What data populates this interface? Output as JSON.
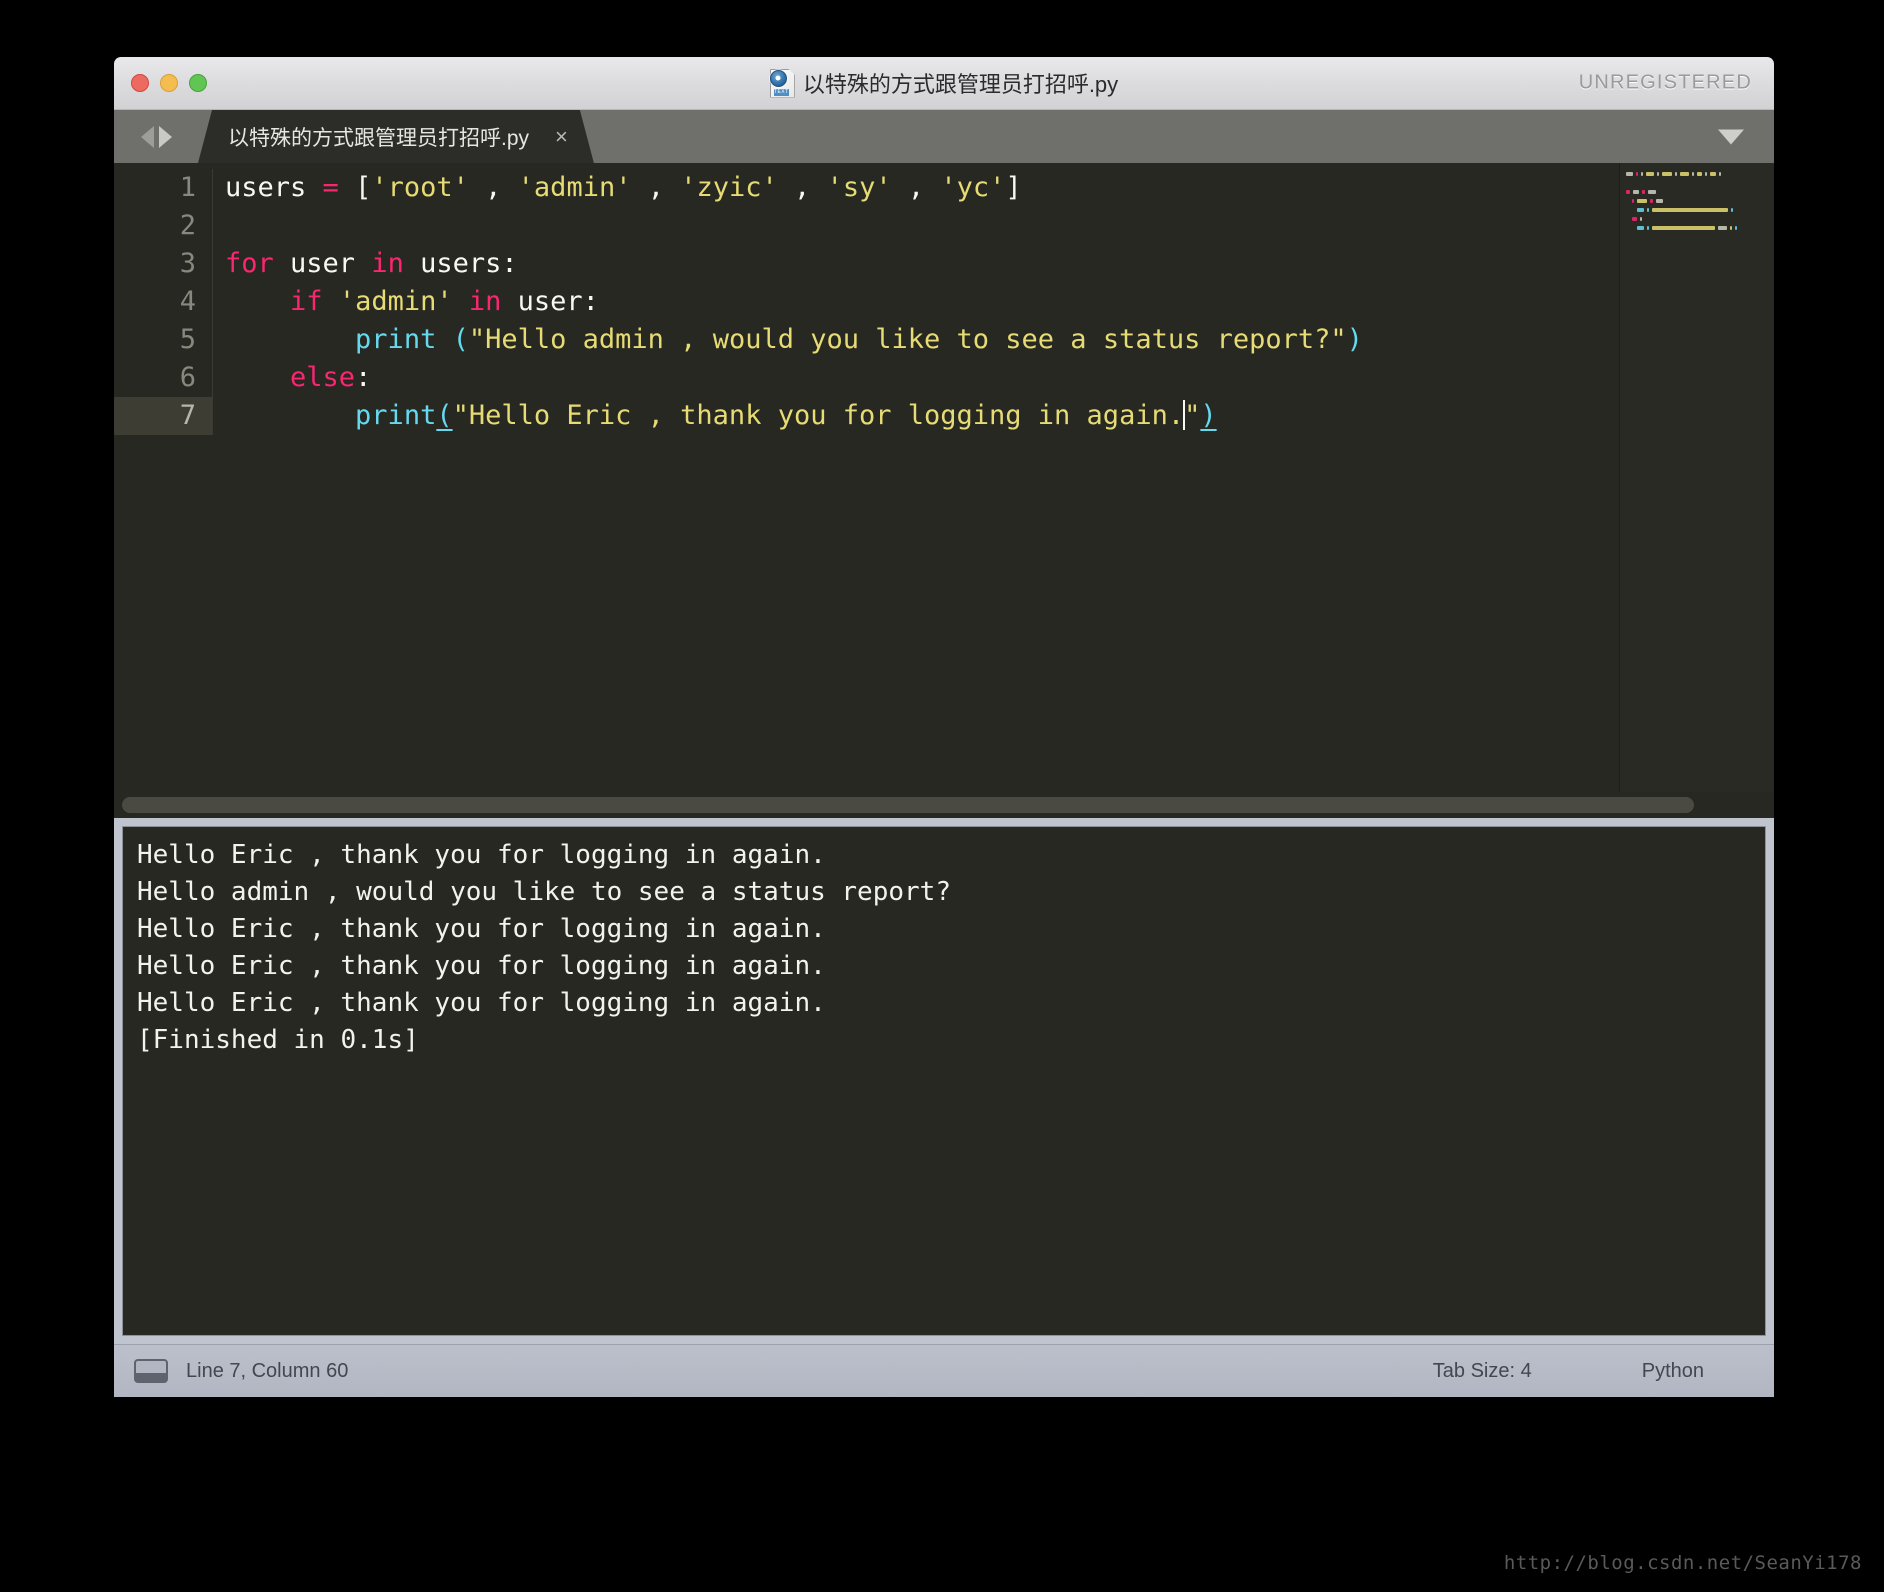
{
  "window": {
    "title": "以特殊的方式跟管理员打招呼.py",
    "unregistered_label": "UNREGISTERED",
    "doc_icon_badge": "TEXT"
  },
  "tabbar": {
    "tab_label": "以特殊的方式跟管理员打招呼.py",
    "close_glyph": "×"
  },
  "editor": {
    "line_numbers": [
      "1",
      "2",
      "3",
      "4",
      "5",
      "6",
      "7"
    ],
    "active_line": 7,
    "lines": [
      {
        "n": 1,
        "tokens": [
          {
            "t": "users ",
            "c": "p"
          },
          {
            "t": "=",
            "c": "k"
          },
          {
            "t": " ",
            "c": "p"
          },
          {
            "t": "[",
            "c": "p"
          },
          {
            "t": "'root'",
            "c": "s"
          },
          {
            "t": " , ",
            "c": "p"
          },
          {
            "t": "'admin'",
            "c": "s"
          },
          {
            "t": " , ",
            "c": "p"
          },
          {
            "t": "'zyic'",
            "c": "s"
          },
          {
            "t": " , ",
            "c": "p"
          },
          {
            "t": "'sy'",
            "c": "s"
          },
          {
            "t": " , ",
            "c": "p"
          },
          {
            "t": "'yc'",
            "c": "s"
          },
          {
            "t": "]",
            "c": "p"
          }
        ]
      },
      {
        "n": 2,
        "tokens": []
      },
      {
        "n": 3,
        "tokens": [
          {
            "t": "for",
            "c": "k"
          },
          {
            "t": " user ",
            "c": "p"
          },
          {
            "t": "in",
            "c": "k"
          },
          {
            "t": " users:",
            "c": "p"
          }
        ]
      },
      {
        "n": 4,
        "tokens": [
          {
            "t": "    ",
            "c": "p"
          },
          {
            "t": "if",
            "c": "k"
          },
          {
            "t": " ",
            "c": "p"
          },
          {
            "t": "'admin'",
            "c": "s"
          },
          {
            "t": " ",
            "c": "p"
          },
          {
            "t": "in",
            "c": "k"
          },
          {
            "t": " user:",
            "c": "p"
          }
        ]
      },
      {
        "n": 5,
        "tokens": [
          {
            "t": "        ",
            "c": "p"
          },
          {
            "t": "print",
            "c": "fn"
          },
          {
            "t": " ",
            "c": "p"
          },
          {
            "t": "(",
            "c": "br"
          },
          {
            "t": "\"Hello admin , would you like to see a status report?\"",
            "c": "s"
          },
          {
            "t": ")",
            "c": "br"
          }
        ]
      },
      {
        "n": 6,
        "tokens": [
          {
            "t": "    ",
            "c": "p"
          },
          {
            "t": "else",
            "c": "k"
          },
          {
            "t": ":",
            "c": "p"
          }
        ]
      },
      {
        "n": 7,
        "tokens": [
          {
            "t": "        ",
            "c": "p"
          },
          {
            "t": "print",
            "c": "fn"
          },
          {
            "t": "(",
            "c": "br match"
          },
          {
            "t": "\"Hello Eric , thank you for logging in again.",
            "c": "s"
          },
          {
            "t": "\u0000CARET",
            "c": "caret"
          },
          {
            "t": "\"",
            "c": "s"
          },
          {
            "t": ")",
            "c": "br match"
          }
        ]
      }
    ],
    "raw_source": "users = ['root' , 'admin' , 'zyic' , 'sy' , 'yc']\n\nfor user in users:\n    if 'admin' in user:\n        print (\"Hello admin , would you like to see a status report?\")\n    else:\n        print(\"Hello Eric , thank you for logging in again.\")"
  },
  "console": {
    "output": "Hello Eric , thank you for logging in again.\nHello admin , would you like to see a status report?\nHello Eric , thank you for logging in again.\nHello Eric , thank you for logging in again.\nHello Eric , thank you for logging in again.\n[Finished in 0.1s]"
  },
  "statusbar": {
    "position": "Line 7, Column 60",
    "tab_size": "Tab Size: 4",
    "syntax": "Python"
  },
  "watermark": {
    "text": "http://blog.csdn.net/SeanYi178"
  },
  "colors": {
    "editor_bg": "#272822",
    "keyword": "#f92672",
    "string": "#e6db74",
    "function": "#66d9ef",
    "plain": "#f8f8f2",
    "active_line_gutter": "#3d3d34",
    "tabbar_bg": "#6f6f6b",
    "statusbar_bg": "#b2b6c2"
  }
}
